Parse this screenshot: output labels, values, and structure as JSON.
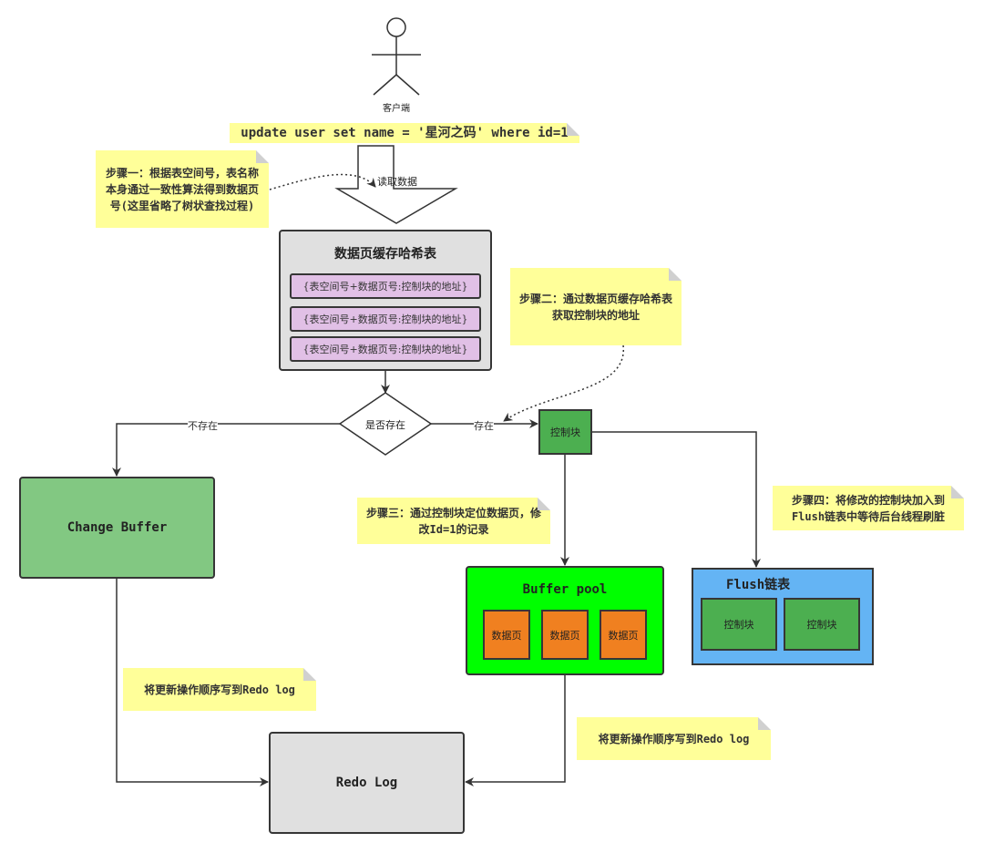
{
  "actor": {
    "label": "客户端"
  },
  "sql_note": "update user set name = '星河之码' where id=1",
  "read_arrow_label": "读取数据",
  "step1_note": "步骤一：根据表空间号，表名称本身通过一致性算法得到数据页号(这里省略了树状查找过程)",
  "hash_table": {
    "title": "数据页缓存哈希表",
    "rows": [
      "{表空间号+数据页号:控制块的地址}",
      "{表空间号+数据页号:控制块的地址}",
      "{表空间号+数据页号:控制块的地址}"
    ]
  },
  "step2_note": "步骤二：通过数据页缓存哈希表获取控制块的地址",
  "decision": {
    "label": "是否存在",
    "no_label": "不存在",
    "yes_label": "存在"
  },
  "control_block": "控制块",
  "change_buffer": "Change Buffer",
  "step3_note": "步骤三：通过控制块定位数据页，修改Id=1的记录",
  "step4_note": "步骤四：将修改的控制块加入到Flush链表中等待后台线程刷脏",
  "buffer_pool": {
    "title": "Buffer pool",
    "pages": [
      "数据页",
      "数据页",
      "数据页"
    ]
  },
  "flush_list": {
    "title": "Flush链表",
    "blocks": [
      "控制块",
      "控制块"
    ]
  },
  "redo_note_left": "将更新操作顺序写到Redo log",
  "redo_note_right": "将更新操作顺序写到Redo log",
  "redo_log": "Redo Log",
  "colors": {
    "note": "#ffff99",
    "hash": "#e0e0e0",
    "row": "#e1c0e6",
    "control": "#4caf50",
    "change_buffer": "#82c882",
    "buffer_pool": "#00ff00",
    "page": "#f08020",
    "flush": "#64b4f4",
    "redo": "#e0e0e0"
  }
}
